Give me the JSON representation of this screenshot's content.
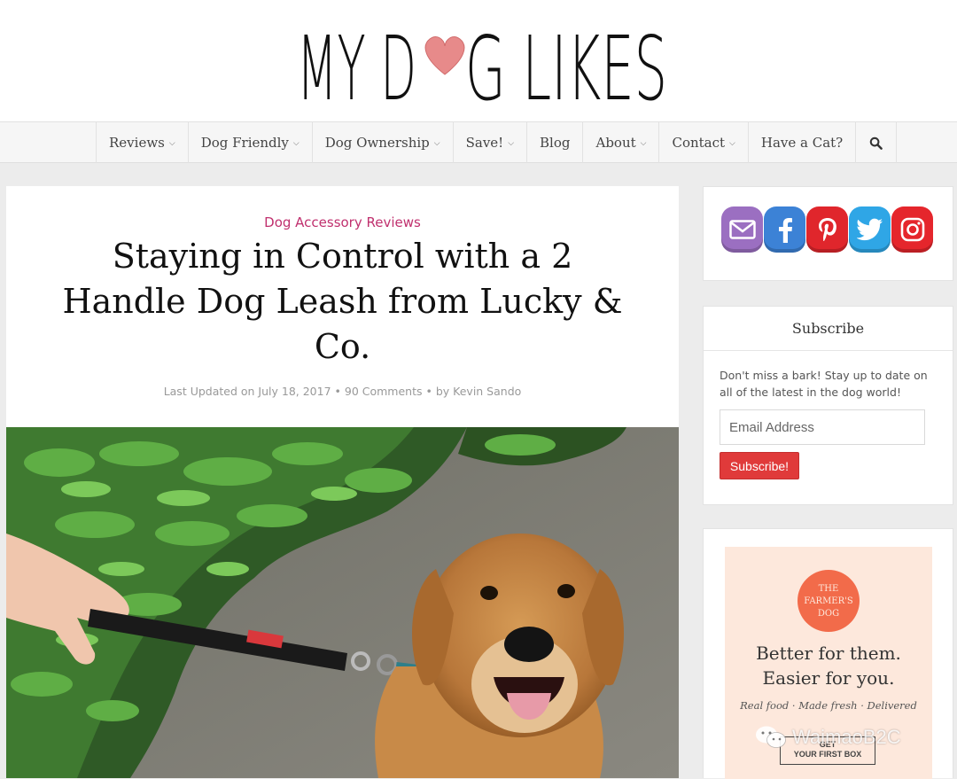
{
  "site": {
    "logo_text_left": "MY D",
    "logo_text_right": "G LIKES",
    "logo_icon": "heart-icon",
    "logo_heart_color": "#e78a8a"
  },
  "nav": {
    "items": [
      {
        "label": "Reviews",
        "dropdown": true
      },
      {
        "label": "Dog Friendly",
        "dropdown": true
      },
      {
        "label": "Dog Ownership",
        "dropdown": true
      },
      {
        "label": "Save!",
        "dropdown": true
      },
      {
        "label": "Blog",
        "dropdown": false
      },
      {
        "label": "About",
        "dropdown": true
      },
      {
        "label": "Contact",
        "dropdown": true
      },
      {
        "label": "Have a Cat?",
        "dropdown": false
      }
    ],
    "chevron": "⌄",
    "search_icon": "search-icon"
  },
  "article": {
    "category": "Dog Accessory Reviews",
    "title_lines": [
      "Staying in Control with a 2",
      "Handle Dog Leash from Lucky &",
      "Co."
    ],
    "meta": {
      "updated": "Last Updated on July 18, 2017",
      "sep1": " • ",
      "comments": "90 Comments",
      "sep2": " • by ",
      "author": "Kevin Sando"
    },
    "image_icon": "dog-photo"
  },
  "sidebar": {
    "social": [
      {
        "name": "email",
        "icon": "email-icon",
        "color": "#9b6fc1"
      },
      {
        "name": "facebook",
        "icon": "facebook-icon",
        "color": "#3c82d6"
      },
      {
        "name": "pinterest",
        "icon": "pinterest-icon",
        "color": "#e0262c"
      },
      {
        "name": "twitter",
        "icon": "twitter-icon",
        "color": "#2fa6e6"
      },
      {
        "name": "instagram",
        "icon": "instagram-icon",
        "color": "#e5262c"
      }
    ],
    "subscribe": {
      "heading": "Subscribe",
      "text": "Don't miss a bark! Stay up to date on all of the latest in the dog world!",
      "email_placeholder": "Email Address",
      "button": "Subscribe!"
    },
    "ad": {
      "badge_line1": "THE",
      "badge_line2": "FARMER'S",
      "badge_line3": "DOG",
      "line1": "Better for them.",
      "line2": "Easier for you.",
      "tagline": "Real food · Made fresh · Delivered",
      "cta_line1": "GET",
      "cta_line2": "YOUR FIRST BOX"
    }
  },
  "watermark": {
    "text": "WaimaoB2C",
    "icon": "wechat-icon"
  }
}
